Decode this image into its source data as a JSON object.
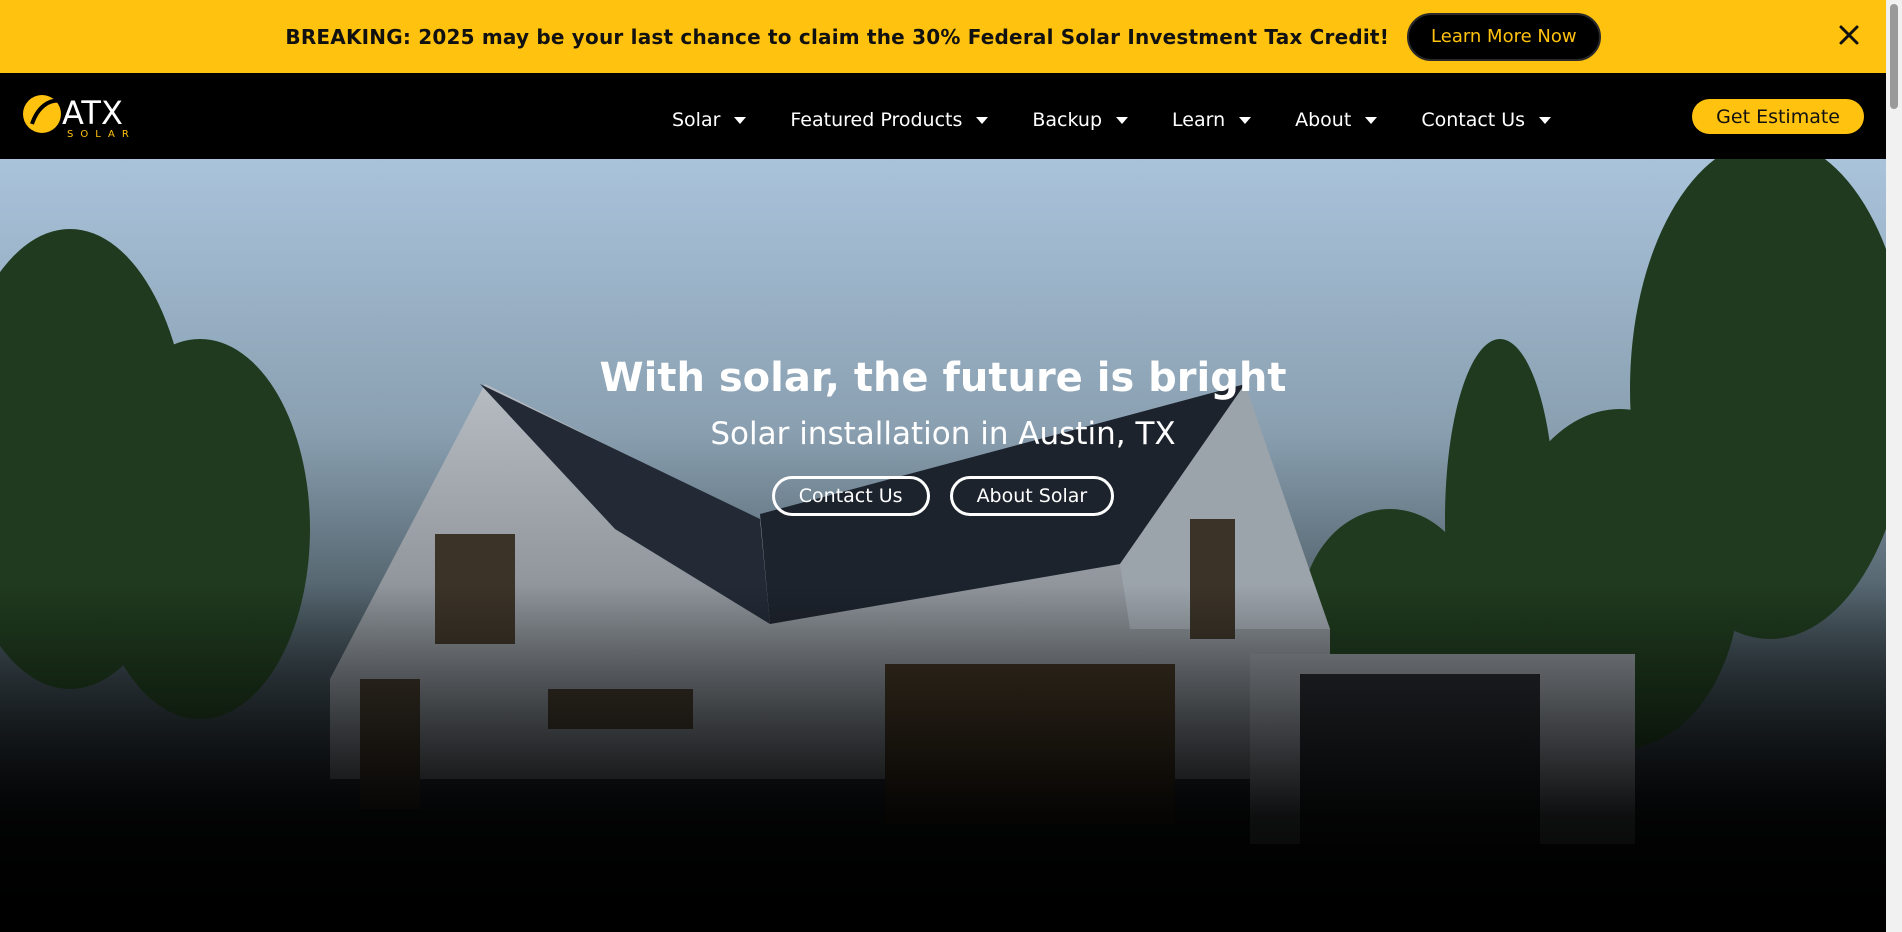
{
  "announcement": {
    "text": "BREAKING: 2025 may be your last chance to claim the 30% Federal Solar Investment Tax Credit!",
    "button_label": "Learn More Now",
    "close_icon": "close-icon"
  },
  "header": {
    "logo_main": "ATX",
    "logo_sub": "SOLAR",
    "nav_items": [
      {
        "label": "Solar"
      },
      {
        "label": "Featured Products"
      },
      {
        "label": "Backup"
      },
      {
        "label": "Learn"
      },
      {
        "label": "About"
      },
      {
        "label": "Contact Us"
      }
    ],
    "cta_label": "Get Estimate"
  },
  "hero": {
    "title": "With solar, the future is bright",
    "subtitle": "Solar installation in Austin, TX",
    "buttons": [
      {
        "label": "Contact Us"
      },
      {
        "label": "About Solar"
      }
    ]
  },
  "colors": {
    "brand_yellow": "#ffc20e",
    "nav_background": "#000000",
    "text_white": "#ffffff"
  }
}
